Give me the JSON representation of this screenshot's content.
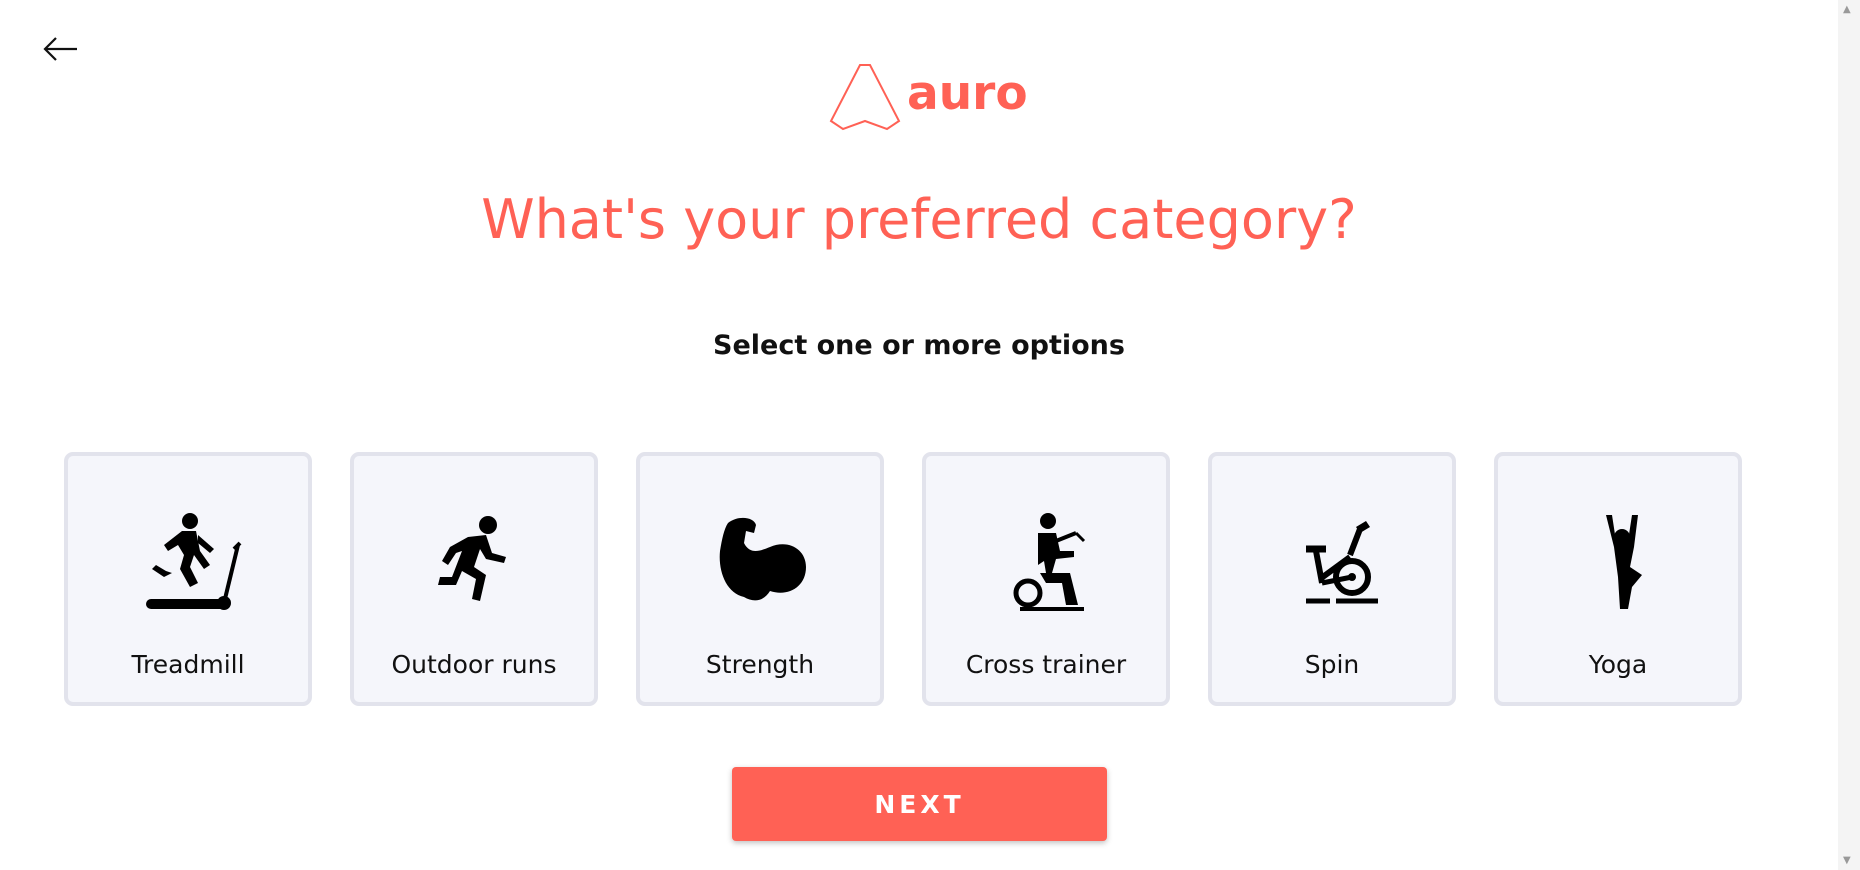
{
  "header": {
    "back_icon": "arrow-left-icon"
  },
  "logo": {
    "text": "auro",
    "icon": "auro-triangle-logo"
  },
  "page": {
    "title": "What's your preferred category?",
    "subtitle": "Select one or more options"
  },
  "categories": [
    {
      "label": "Treadmill",
      "icon": "treadmill-icon"
    },
    {
      "label": "Outdoor runs",
      "icon": "running-icon"
    },
    {
      "label": "Strength",
      "icon": "bicep-icon"
    },
    {
      "label": "Cross trainer",
      "icon": "cross-trainer-icon"
    },
    {
      "label": "Spin",
      "icon": "spin-bike-icon"
    },
    {
      "label": "Yoga",
      "icon": "yoga-icon"
    }
  ],
  "actions": {
    "next_label": "NEXT"
  },
  "colors": {
    "accent": "#ff6155",
    "card_border": "#e2e3ec",
    "card_background": "#f5f6fb",
    "text": "#111111"
  }
}
